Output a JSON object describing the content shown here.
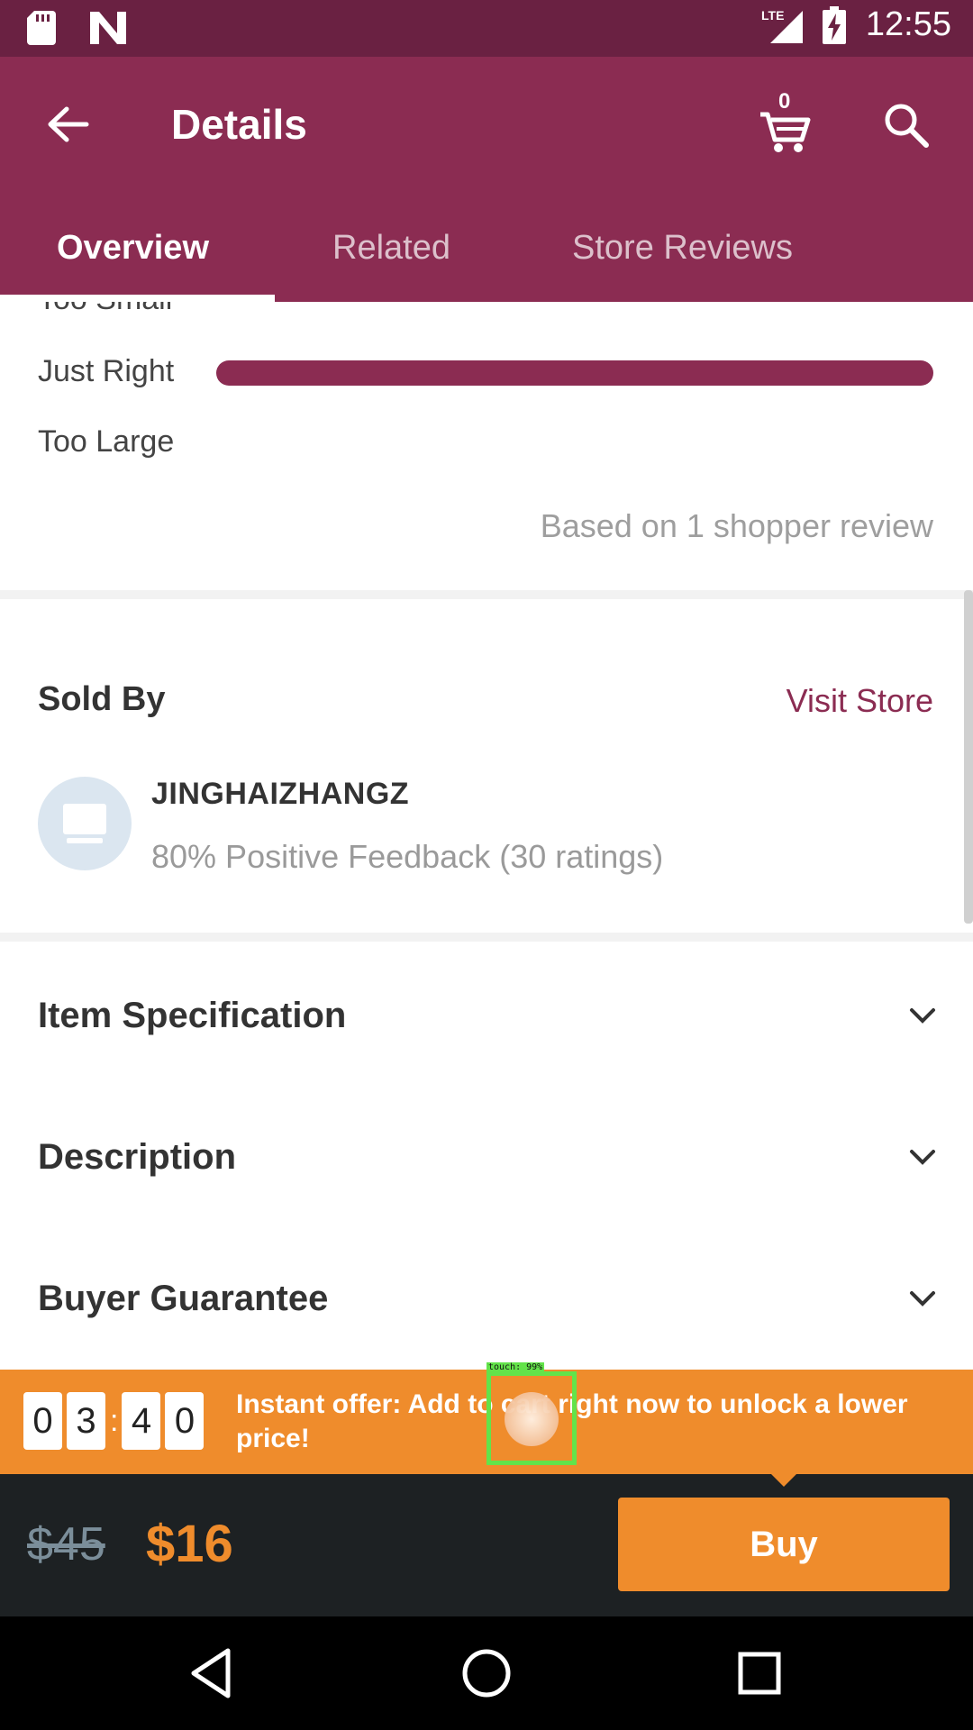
{
  "status_bar": {
    "time": "12:55",
    "network": "LTE"
  },
  "app_bar": {
    "title": "Details",
    "cart_count": "0"
  },
  "tabs": [
    {
      "label": "Overview",
      "active": true
    },
    {
      "label": "Related",
      "active": false
    },
    {
      "label": "Store Reviews",
      "active": false
    }
  ],
  "fit": {
    "rows": [
      "Too Small",
      "Just Right",
      "Too Large"
    ],
    "just_right_fraction": 1.0,
    "review_note": "Based on 1 shopper review"
  },
  "seller": {
    "heading": "Sold By",
    "visit_label": "Visit Store",
    "name": "JINGHAIZHANGZ",
    "feedback": "80% Positive Feedback (30 ratings)"
  },
  "sections": [
    "Item Specification",
    "Description",
    "Buyer Guarantee"
  ],
  "offer": {
    "timer": [
      "0",
      "3",
      "4",
      "0"
    ],
    "text": "Instant offer: Add to cart right now to unlock a lower price!"
  },
  "touch_label": "touch: 99%",
  "purchase": {
    "old_price": "$45",
    "new_price": "$16",
    "buy_label": "Buy"
  },
  "colors": {
    "brand": "#8b2c52",
    "status": "#6a2142",
    "accent": "#ef8c2c",
    "bottom": "#1d2123"
  }
}
